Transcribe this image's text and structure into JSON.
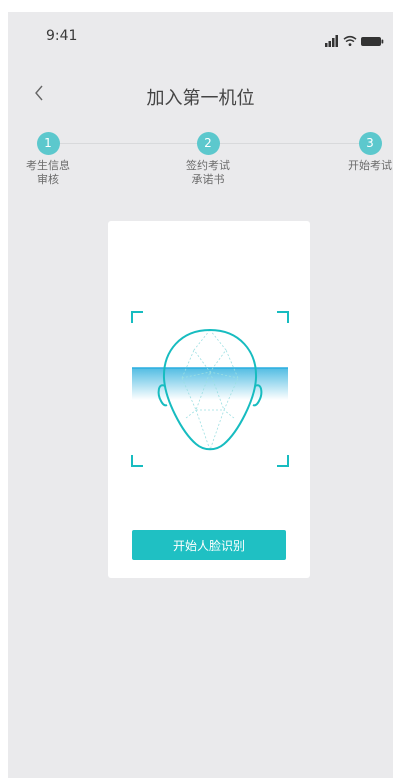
{
  "status_bar": {
    "time": "9:41",
    "icons": [
      "signal-icon",
      "wifi-icon",
      "battery-icon"
    ]
  },
  "nav": {
    "title": "加入第一机位",
    "back_icon": "chevron-left-icon"
  },
  "stepper": {
    "steps": [
      {
        "number": "1",
        "label_line1": "考生信息",
        "label_line2": "审核"
      },
      {
        "number": "2",
        "label_line1": "签约考试",
        "label_line2": "承诺书"
      },
      {
        "number": "3",
        "label_line1": "开始考试",
        "label_line2": ""
      }
    ]
  },
  "card": {
    "icon": "face-scan-icon",
    "start_button_label": "开始人脸识别"
  },
  "colors": {
    "accent": "#1fc0c3",
    "step_circle": "#5cc8cd",
    "background": "#eaeaec",
    "card": "#ffffff"
  }
}
